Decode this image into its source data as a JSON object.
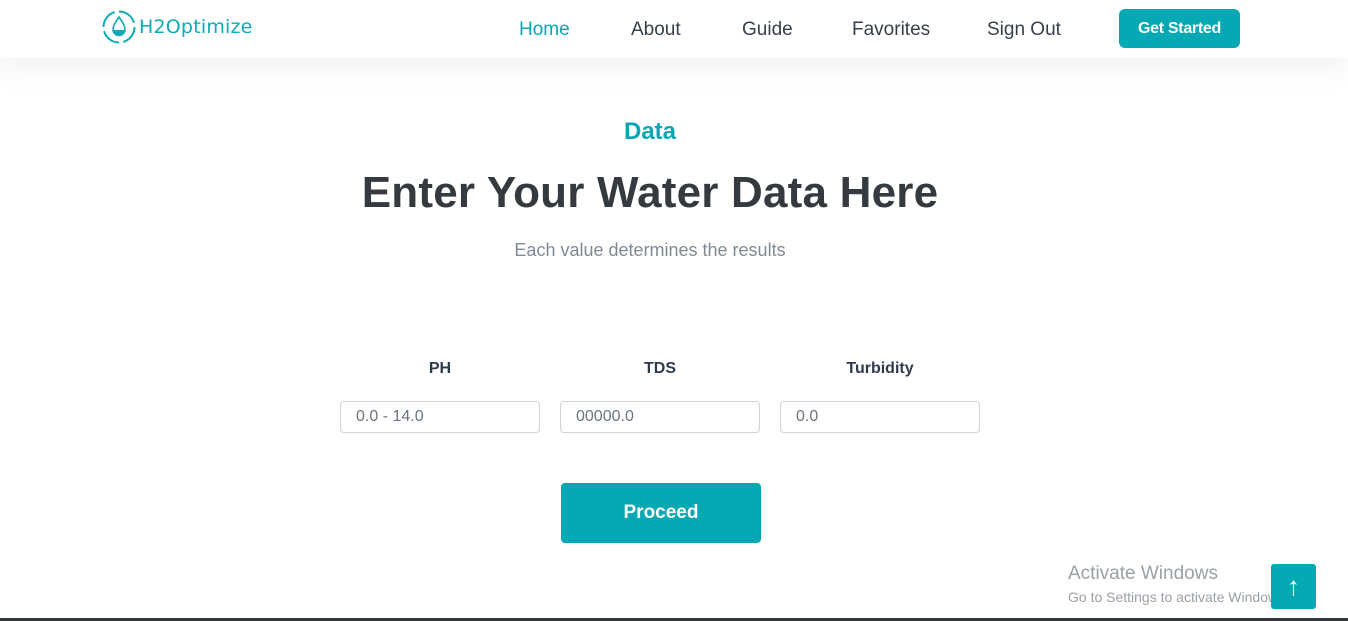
{
  "brand": {
    "name": "H2Optimize",
    "icon": "water-drop-logo-icon",
    "accent": "#0aa7b3"
  },
  "nav": {
    "items": [
      {
        "label": "Home",
        "active": true
      },
      {
        "label": "About",
        "active": false
      },
      {
        "label": "Guide",
        "active": false
      },
      {
        "label": "Favorites",
        "active": false
      },
      {
        "label": "Sign Out",
        "active": false
      }
    ],
    "cta_label": "Get Started"
  },
  "section": {
    "eyebrow": "Data",
    "title": "Enter Your Water Data Here",
    "subtitle": "Each value determines the results"
  },
  "form": {
    "fields": [
      {
        "label": "PH",
        "placeholder": "0.0 - 14.0",
        "value": ""
      },
      {
        "label": "TDS",
        "placeholder": "00000.0",
        "value": ""
      },
      {
        "label": "Turbidity",
        "placeholder": "0.0",
        "value": ""
      }
    ],
    "submit_label": "Proceed"
  },
  "watermark": {
    "title": "Activate Windows",
    "subtitle": "Go to Settings to activate Windows."
  },
  "back_to_top": {
    "icon": "arrow-up-icon",
    "glyph": "↑"
  },
  "colors": {
    "primary": "#05a9b3",
    "heading": "#343a40",
    "muted": "#808a94"
  }
}
